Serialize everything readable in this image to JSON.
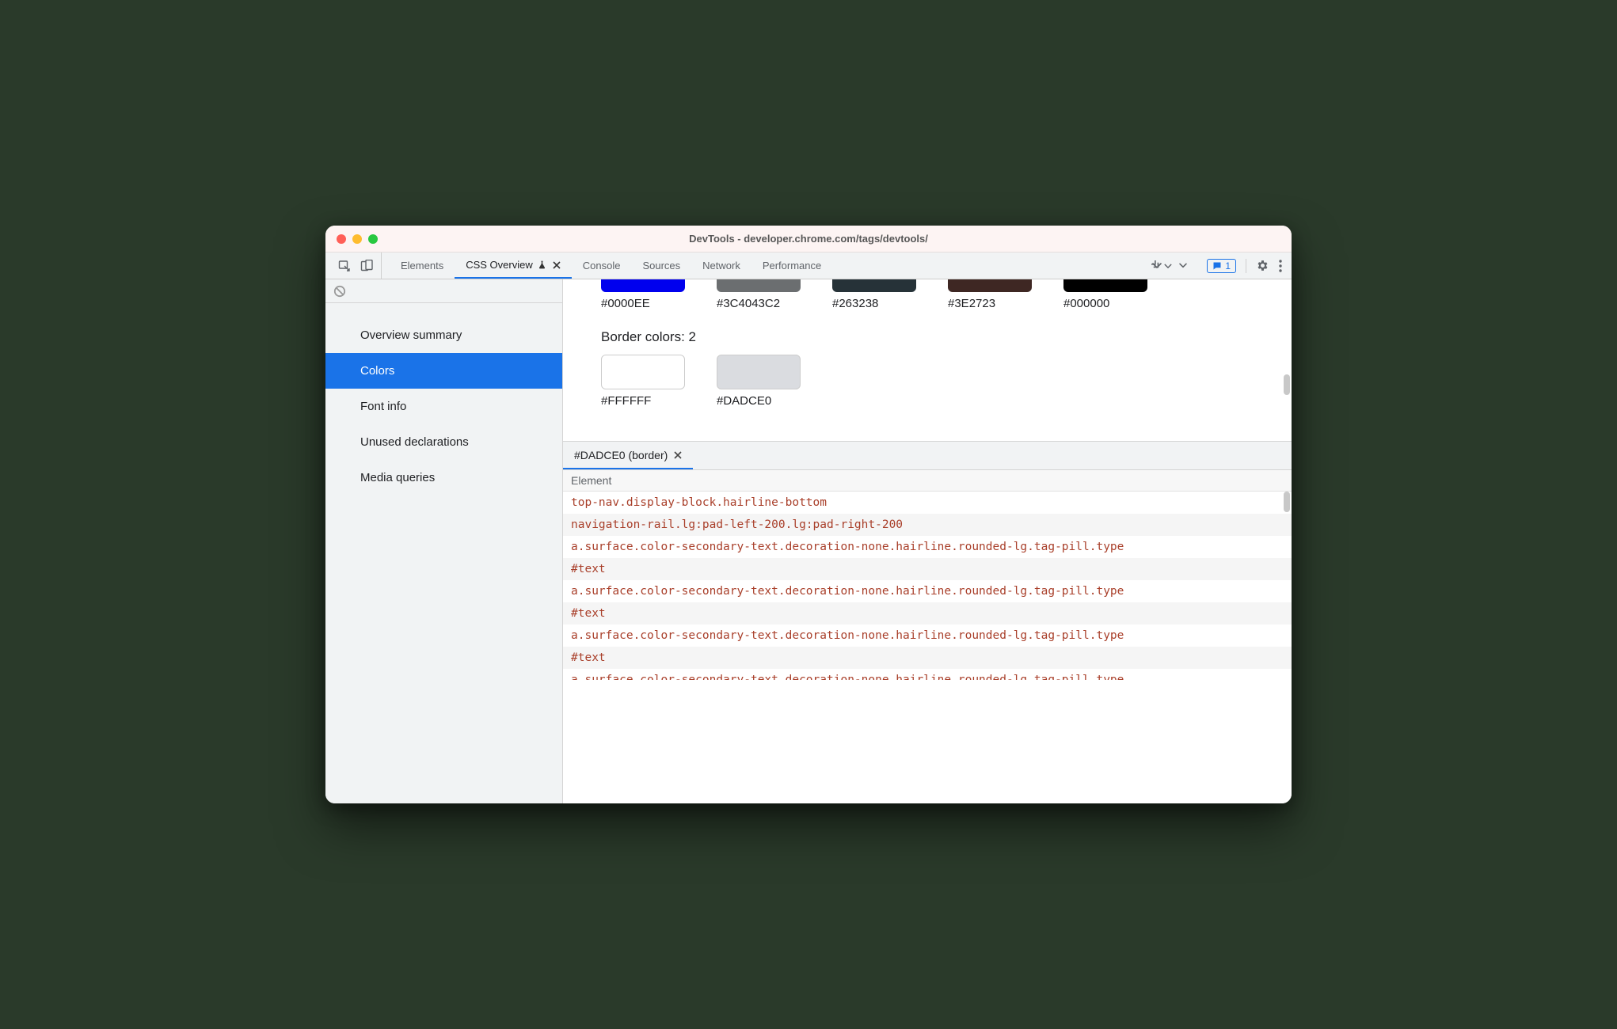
{
  "window_title": "DevTools - developer.chrome.com/tags/devtools/",
  "tabs": {
    "items": [
      "Elements",
      "CSS Overview",
      "Console",
      "Sources",
      "Network",
      "Performance"
    ],
    "active_index": 1
  },
  "issues_count": "1",
  "sidebar": {
    "items": [
      "Overview summary",
      "Colors",
      "Font info",
      "Unused declarations",
      "Media queries"
    ],
    "selected_index": 1
  },
  "top_swatches": [
    {
      "color": "#0000EE",
      "label": "#0000EE"
    },
    {
      "color": "rgba(60,64,67,0.76)",
      "label": "#3C4043C2"
    },
    {
      "color": "#263238",
      "label": "#263238"
    },
    {
      "color": "#3E2723",
      "label": "#3E2723"
    },
    {
      "color": "#000000",
      "label": "#000000"
    }
  ],
  "border_section_title": "Border colors: 2",
  "border_swatches": [
    {
      "color": "#FFFFFF",
      "label": "#FFFFFF",
      "needs_border": true
    },
    {
      "color": "#DADCE0",
      "label": "#DADCE0",
      "needs_border": true
    }
  ],
  "detail_tab_label": "#DADCE0 (border)",
  "detail_column_header": "Element",
  "elements": [
    "top-nav.display-block.hairline-bottom",
    "navigation-rail.lg:pad-left-200.lg:pad-right-200",
    "a.surface.color-secondary-text.decoration-none.hairline.rounded-lg.tag-pill.type",
    "#text",
    "a.surface.color-secondary-text.decoration-none.hairline.rounded-lg.tag-pill.type",
    "#text",
    "a.surface.color-secondary-text.decoration-none.hairline.rounded-lg.tag-pill.type",
    "#text",
    "a.surface.color-secondary-text.decoration-none.hairline.rounded-lg.tag-pill.type"
  ]
}
